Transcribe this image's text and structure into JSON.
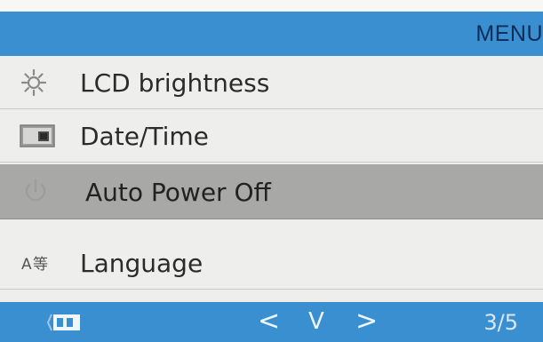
{
  "header": {
    "title": "MENU"
  },
  "menu": {
    "items": [
      {
        "label": "LCD brightness",
        "icon": "brightness-sun-icon",
        "selected": false
      },
      {
        "label": "Date/Time",
        "icon": "calendar-clock-icon",
        "selected": false
      },
      {
        "label": "Auto Power Off",
        "icon": "power-off-icon",
        "selected": true
      },
      {
        "label": "Language",
        "icon": "language-icon",
        "selected": false
      }
    ]
  },
  "footer": {
    "prev_symbol": "<",
    "select_symbol": "V",
    "next_symbol": ">",
    "page_indicator": "3/5",
    "battery_icon": "battery-icon"
  },
  "colors": {
    "bar_blue": "#3a8fd0",
    "selected_row": "#a8a8a6",
    "list_bg": "#eeeeec",
    "title_text": "#0d2c56"
  }
}
